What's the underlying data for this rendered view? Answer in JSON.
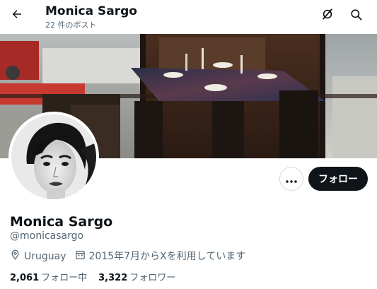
{
  "header": {
    "name": "Monica Sargo",
    "post_count": "22 件のポスト"
  },
  "profile": {
    "display_name": "Monica Sargo",
    "handle": "@monicasargo",
    "location": "Uruguay",
    "joined": "2015年7月からXを利用しています",
    "following_count": "2,061",
    "following_label": "フォロー中",
    "followers_count": "3,322",
    "followers_label": "フォロワー"
  },
  "actions": {
    "follow_label": "フォロー"
  },
  "icons": {
    "back": "arrow-left-icon",
    "refresh": "grok-icon",
    "search": "search-icon",
    "more": "more-icon",
    "location": "location-pin-icon",
    "calendar": "calendar-icon"
  },
  "colors": {
    "text_primary": "#0f1419",
    "text_secondary": "#536471",
    "button_dark": "#0f1419",
    "border": "#cfd9de"
  }
}
